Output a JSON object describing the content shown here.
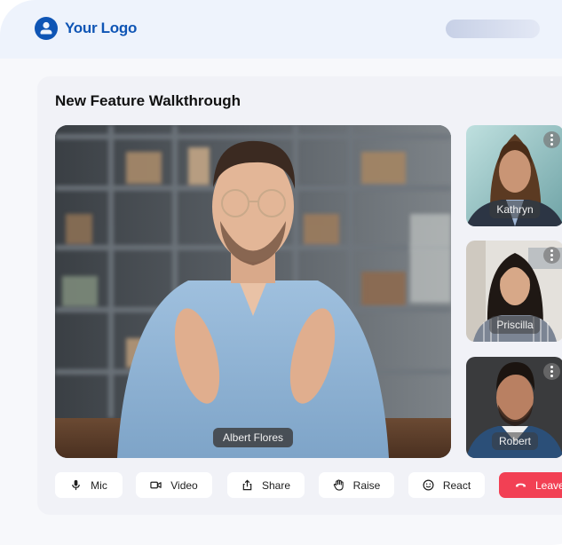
{
  "header": {
    "logo_text": "Your Logo",
    "logo_icon": "user-circle-icon",
    "brand_color": "#0f55b5"
  },
  "meeting": {
    "title": "New Feature Walkthrough",
    "main_speaker": {
      "name": "Albert Flores"
    },
    "participants": [
      {
        "name": "Kathryn",
        "menu_icon": "more-vertical-icon"
      },
      {
        "name": "Priscilla",
        "menu_icon": "more-vertical-icon"
      },
      {
        "name": "Robert",
        "menu_icon": "more-vertical-icon"
      }
    ]
  },
  "controls": [
    {
      "label": "Mic",
      "icon": "microphone-icon"
    },
    {
      "label": "Video",
      "icon": "video-camera-icon"
    },
    {
      "label": "Share",
      "icon": "share-upload-icon"
    },
    {
      "label": "Raise",
      "icon": "raise-hand-icon"
    },
    {
      "label": "React",
      "icon": "smiley-icon"
    },
    {
      "label": "Leave",
      "icon": "hang-up-phone-icon",
      "color": "#f24054"
    }
  ]
}
